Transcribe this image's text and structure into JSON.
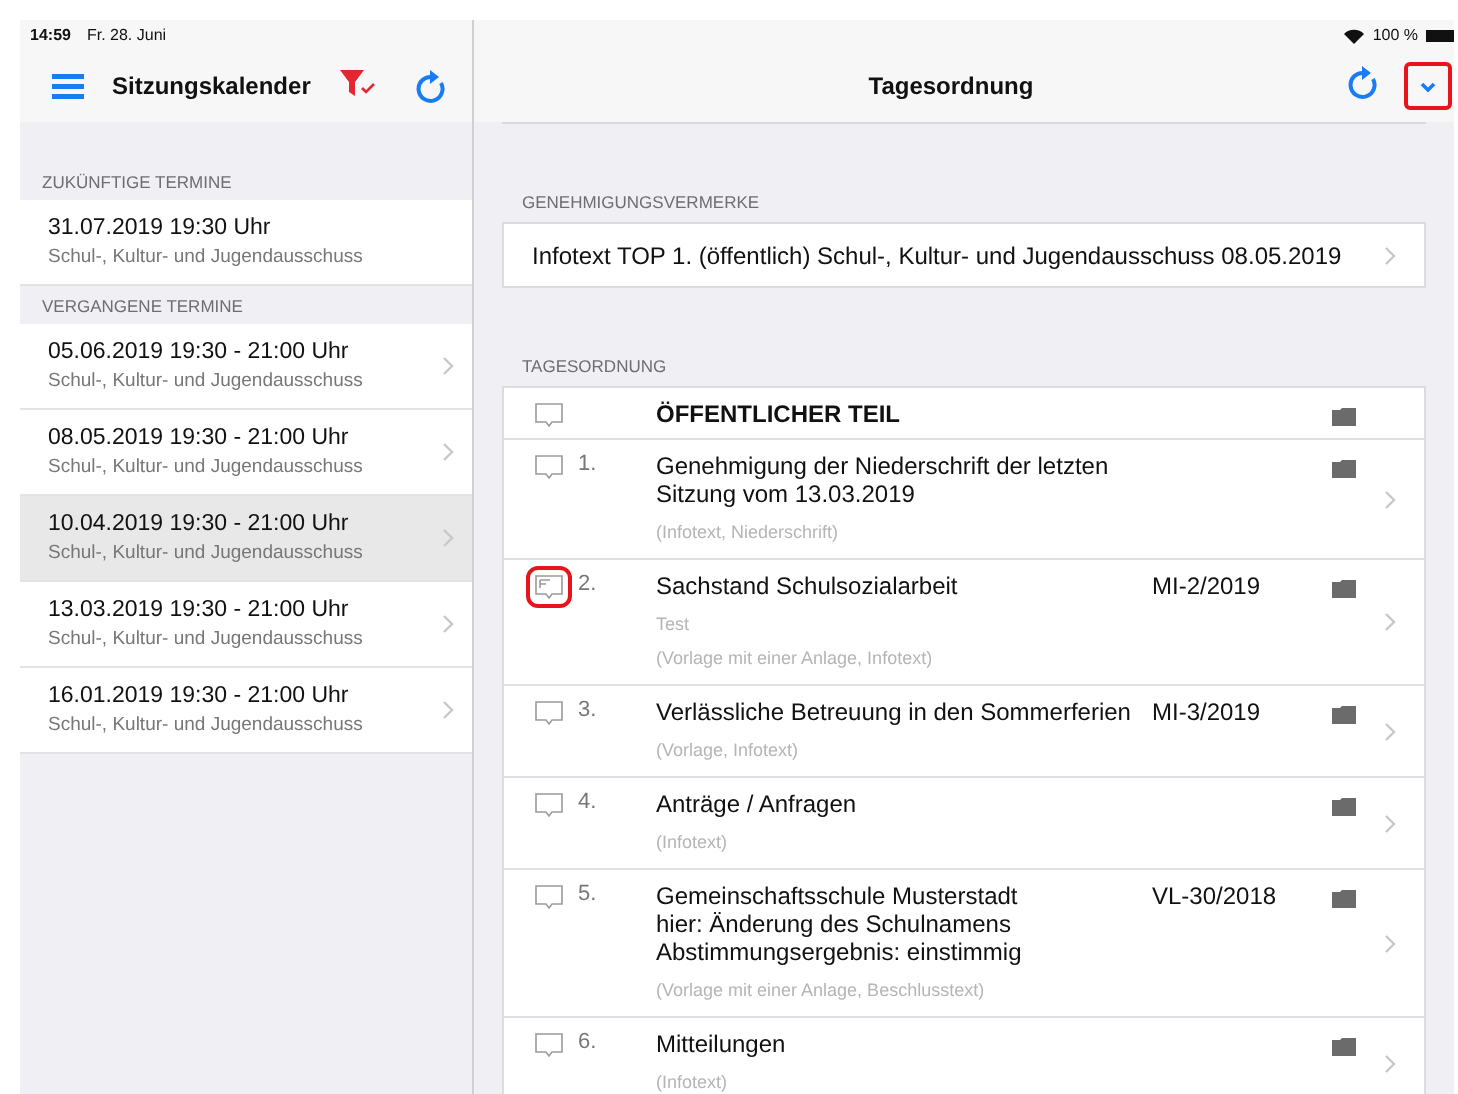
{
  "status_bar": {
    "time": "14:59",
    "date": "Fr. 28. Juni",
    "battery": "100 %"
  },
  "sidebar": {
    "title": "Sitzungskalender",
    "sections": [
      {
        "title": "ZUKÜNFTIGE TERMINE",
        "items": [
          {
            "datetime": "31.07.2019 19:30 Uhr",
            "committee": "Schul-, Kultur- und Jugendausschuss",
            "selected": false,
            "chevron": false
          }
        ]
      },
      {
        "title": "VERGANGENE TERMINE",
        "items": [
          {
            "datetime": "05.06.2019 19:30 -  21:00 Uhr",
            "committee": "Schul-, Kultur- und Jugendausschuss",
            "selected": false,
            "chevron": true
          },
          {
            "datetime": "08.05.2019 19:30 -  21:00 Uhr",
            "committee": "Schul-, Kultur- und Jugendausschuss",
            "selected": false,
            "chevron": true
          },
          {
            "datetime": "10.04.2019 19:30 -  21:00 Uhr",
            "committee": "Schul-, Kultur- und Jugendausschuss",
            "selected": true,
            "chevron": true
          },
          {
            "datetime": "13.03.2019 19:30 -  21:00 Uhr",
            "committee": "Schul-, Kultur- und Jugendausschuss",
            "selected": false,
            "chevron": true
          },
          {
            "datetime": "16.01.2019 19:30 -  21:00 Uhr",
            "committee": "Schul-, Kultur- und Jugendausschuss",
            "selected": false,
            "chevron": true
          }
        ]
      }
    ]
  },
  "main": {
    "title": "Tagesordnung",
    "dropdown_button": {
      "highlighted": true
    },
    "approvals": {
      "title": "GENEHMIGUNGSVERMERKE",
      "items": [
        "Infotext TOP 1. (öffentlich) Schul-, Kultur- und Jugendausschuss 08.05.2019"
      ]
    },
    "agenda": {
      "title": "TAGESORDNUNG",
      "items": [
        {
          "kind": "heading",
          "title": "ÖFFENTLICHER TEIL",
          "has_note": false,
          "highlighted": false
        },
        {
          "kind": "item",
          "number": "1.",
          "title": "Genehmigung der Niederschrift der letzten Sitzung vom 13.03.2019",
          "details": "(Infotext, Niederschrift)",
          "has_note": false,
          "highlighted": false
        },
        {
          "kind": "item",
          "number": "2.",
          "title": "Sachstand Schulsozialarbeit",
          "code": "MI-2/2019",
          "subtitle": "Test",
          "details": "(Vorlage mit einer Anlage, Infotext)",
          "has_note": true,
          "highlighted": true
        },
        {
          "kind": "item",
          "number": "3.",
          "title": "Verlässliche Betreuung in den Sommerferien",
          "code": "MI-3/2019",
          "details": "(Vorlage, Infotext)",
          "has_note": false,
          "highlighted": false
        },
        {
          "kind": "item",
          "number": "4.",
          "title": "Anträge / Anfragen",
          "details": "(Infotext)",
          "has_note": false,
          "highlighted": false
        },
        {
          "kind": "item",
          "number": "5.",
          "title": "Gemeinschaftsschule Musterstadt\nhier: Änderung des Schulnamens\nAbstimmungsergebnis: einstimmig",
          "code": "VL-30/2018",
          "details": "(Vorlage mit einer Anlage, Beschlusstext)",
          "has_note": false,
          "highlighted": false
        },
        {
          "kind": "item",
          "number": "6.",
          "title": "Mitteilungen",
          "details": "(Infotext)",
          "has_note": false,
          "highlighted": false
        }
      ]
    }
  }
}
